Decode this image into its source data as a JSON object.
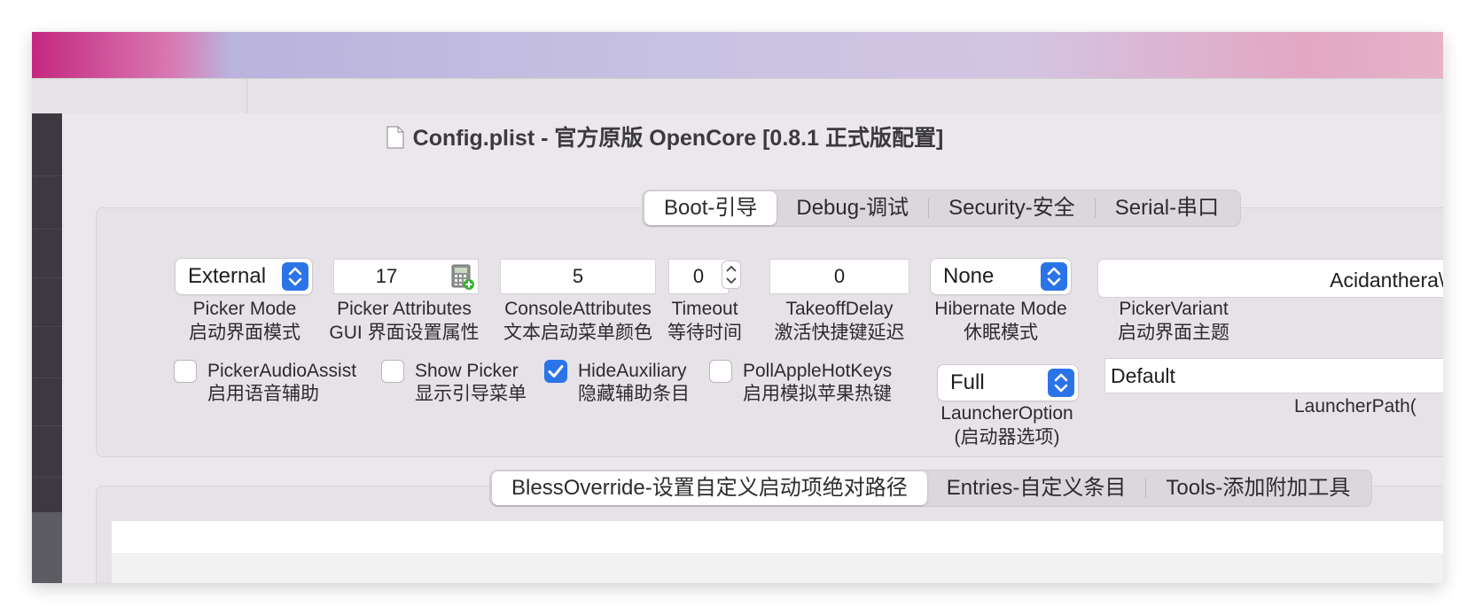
{
  "window": {
    "title": "Config.plist - 官方原版 OpenCore [0.8.1 正式版配置]"
  },
  "top_tabs": [
    {
      "label": "Boot-引导",
      "active": true
    },
    {
      "label": "Debug-调试",
      "active": false
    },
    {
      "label": "Security-安全",
      "active": false
    },
    {
      "label": "Serial-串口",
      "active": false
    }
  ],
  "fields": {
    "picker_mode": {
      "value": "External",
      "label1": "Picker Mode",
      "label2": "启动界面模式"
    },
    "picker_attributes": {
      "value": "17",
      "label1": "Picker Attributes",
      "label2": "GUI 界面设置属性"
    },
    "console_attributes": {
      "value": "5",
      "label1": "ConsoleAttributes",
      "label2": "文本启动菜单颜色"
    },
    "timeout": {
      "value": "0",
      "label1": "Timeout",
      "label2": "等待时间"
    },
    "takeoff_delay": {
      "value": "0",
      "label1": "TakeoffDelay",
      "label2": "激活快捷键延迟"
    },
    "hibernate_mode": {
      "value": "None",
      "label1": "Hibernate Mode",
      "label2": "休眠模式"
    },
    "picker_variant": {
      "value": "Acidanthera\\Cl",
      "label1": "PickerVariant",
      "label2": "启动界面主题"
    },
    "launcher_option": {
      "value": "Full",
      "label1": "LauncherOption",
      "label2": "(启动器选项)"
    },
    "launcher_path": {
      "value": "Default",
      "label1": "LauncherPath("
    }
  },
  "checkboxes": [
    {
      "label1": "PickerAudioAssist",
      "label2": "启用语音辅助",
      "checked": false
    },
    {
      "label1": "Show Picker",
      "label2": "显示引导菜单",
      "checked": false
    },
    {
      "label1": "HideAuxiliary",
      "label2": "隐藏辅助条目",
      "checked": true
    },
    {
      "label1": "PollAppleHotKeys",
      "label2": "启用模拟苹果热键",
      "checked": false
    }
  ],
  "bottom_tabs": [
    {
      "label": "BlessOverride-设置自定义启动项绝对路径",
      "active": true
    },
    {
      "label": "Entries-自定义条目",
      "active": false
    },
    {
      "label": "Tools-添加附加工具",
      "active": false
    }
  ],
  "colors": {
    "accent": "#2b74e8",
    "window_bg": "#ece7ec",
    "wallpaper_left": "#c4287f"
  },
  "icons": {
    "document": "doc-icon",
    "calculator": "calculator-icon",
    "popup_arrows": "chevron-updown-icon",
    "stepper": "stepper-icon",
    "checkmark": "checkmark-icon"
  }
}
